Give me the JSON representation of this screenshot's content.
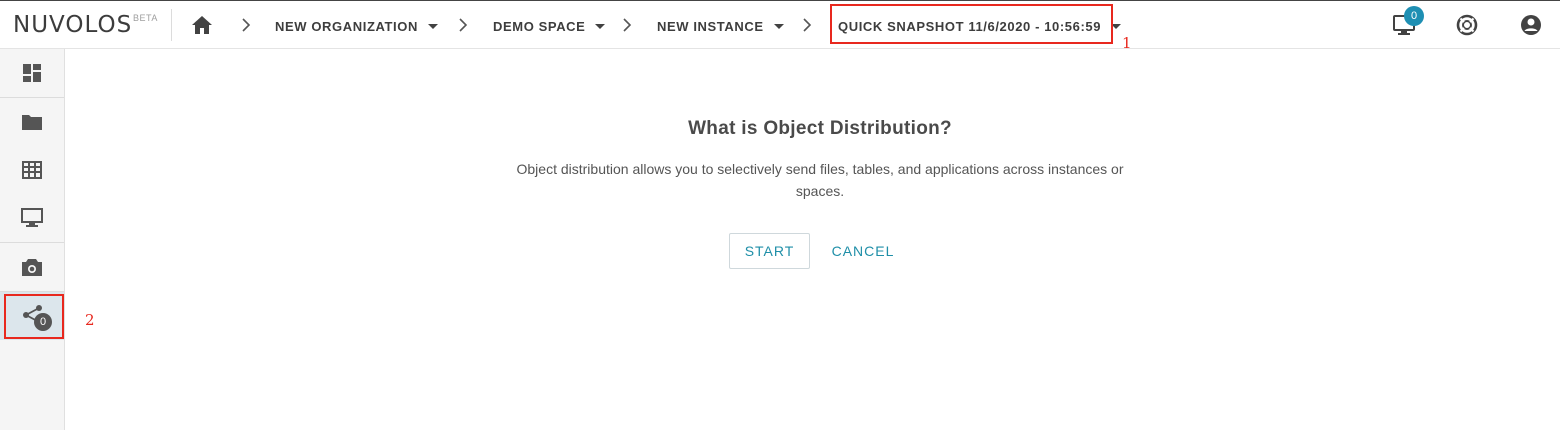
{
  "header": {
    "logo": "NUVOLOS",
    "logo_badge": "BETA",
    "breadcrumbs": [
      {
        "label": "NEW ORGANIZATION"
      },
      {
        "label": "DEMO SPACE"
      },
      {
        "label": "NEW INSTANCE"
      },
      {
        "label": "QUICK SNAPSHOT 11/6/2020 - 10:56:59"
      }
    ],
    "desktop_badge": "0",
    "icons": [
      "home-icon",
      "chevron-right-icon",
      "caret-down-icon",
      "desktop-icon",
      "lifebuoy-icon",
      "account-icon"
    ]
  },
  "sidebar": {
    "items": [
      {
        "icon": "dashboard-icon"
      },
      {
        "icon": "folder-icon"
      },
      {
        "icon": "table-icon"
      },
      {
        "icon": "desktop-icon"
      },
      {
        "icon": "camera-icon"
      },
      {
        "icon": "share-icon",
        "badge": "0",
        "active": true
      }
    ]
  },
  "annotations": {
    "label_1": "1",
    "label_2": "2",
    "color": "#e8281e"
  },
  "main": {
    "title": "What is Object Distribution?",
    "description": "Object distribution allows you to selectively send files, tables, and applications across instances or spaces.",
    "start_label": "START",
    "cancel_label": "CANCEL"
  },
  "colors": {
    "accent": "#1f8fa8",
    "badge": "#1e8fb3",
    "active_sidebar": "#dce6ec"
  }
}
